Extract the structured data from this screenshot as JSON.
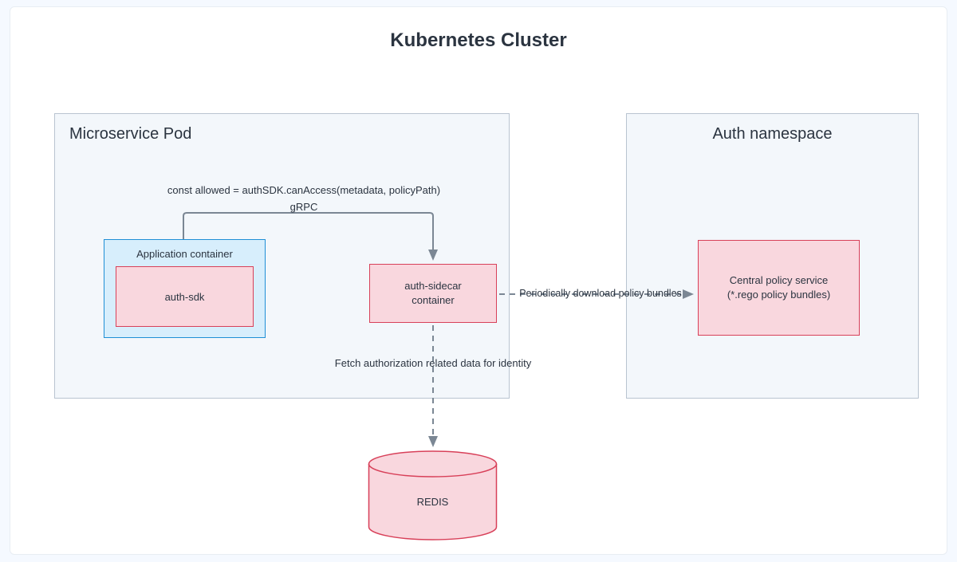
{
  "title": "Kubernetes Cluster",
  "pod": {
    "title": "Microservice Pod",
    "app_container_label": "Application container",
    "sdk_label": "auth-sdk",
    "sidecar_label": "auth-sidecar\ncontainer"
  },
  "authns": {
    "title": "Auth namespace",
    "policy_label": "Central policy service\n(*.rego policy bundles)"
  },
  "redis_label": "REDIS",
  "arrows": {
    "code": "const allowed = authSDK.canAccess(metadata,  policyPath)",
    "grpc": "gRPC",
    "download": "Periodically download policy bundles",
    "fetch": "Fetch authorization related data for identity"
  },
  "colors": {
    "pink_fill": "#f9d7de",
    "pink_stroke": "#d84059",
    "blue_fill": "#d7eefc",
    "blue_stroke": "#1f8fd6",
    "group_fill": "#f3f7fb",
    "group_stroke": "#b9c4d0",
    "arrow": "#7b8794"
  }
}
